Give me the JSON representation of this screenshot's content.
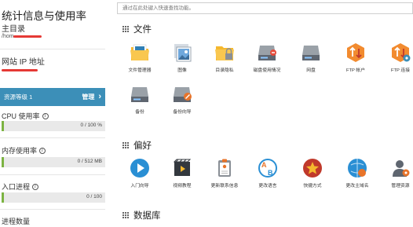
{
  "sidebar": {
    "title": "统计信息与使用率",
    "home_dir_label": "主目录",
    "home_dir_value": "/hom",
    "site_ip_label": "网站 IP 地址",
    "plan_name": "资源等级 1",
    "manage_label": "管理",
    "metrics": [
      {
        "label": "CPU 使用率",
        "value_text": "0 / 100 %",
        "fraction": 0.0
      },
      {
        "label": "内存使用率",
        "value_text": "0 / 512 MB",
        "fraction": 0.0
      },
      {
        "label": "入口进程",
        "value_text": "0 / 100",
        "fraction": 0.0
      }
    ],
    "last_metric_label": "进程数量"
  },
  "search": {
    "placeholder": "通过在此处键入快速查找功能。"
  },
  "sections": [
    {
      "title": "文件",
      "items": [
        {
          "label": "文件管理器",
          "icon": "file-manager-icon"
        },
        {
          "label": "图像",
          "icon": "images-icon"
        },
        {
          "label": "目录隐私",
          "icon": "directory-privacy-icon"
        },
        {
          "label": "磁盘使用情况",
          "icon": "disk-usage-icon"
        },
        {
          "label": "网盘",
          "icon": "web-disk-icon"
        },
        {
          "label": "FTP 帐户",
          "icon": "ftp-accounts-icon"
        },
        {
          "label": "FTP 连接",
          "icon": "ftp-connections-icon"
        },
        {
          "label": "备份",
          "icon": "backup-icon"
        },
        {
          "label": "备份向导",
          "icon": "backup-wizard-icon"
        }
      ]
    },
    {
      "title": "偏好",
      "items": [
        {
          "label": "入门向导",
          "icon": "getting-started-icon"
        },
        {
          "label": "视频教程",
          "icon": "video-tutorials-icon"
        },
        {
          "label": "更新联系信息",
          "icon": "contact-info-icon"
        },
        {
          "label": "更改语言",
          "icon": "change-language-icon"
        },
        {
          "label": "快捷方式",
          "icon": "shortcuts-icon"
        },
        {
          "label": "更改主域名",
          "icon": "change-main-domain-icon"
        },
        {
          "label": "管理资源",
          "icon": "user-manager-icon"
        }
      ]
    },
    {
      "title": "数据库"
    }
  ],
  "colors": {
    "accent": "#3c8fb8",
    "bar_green": "#7cb342",
    "redaction": "#e53935"
  }
}
